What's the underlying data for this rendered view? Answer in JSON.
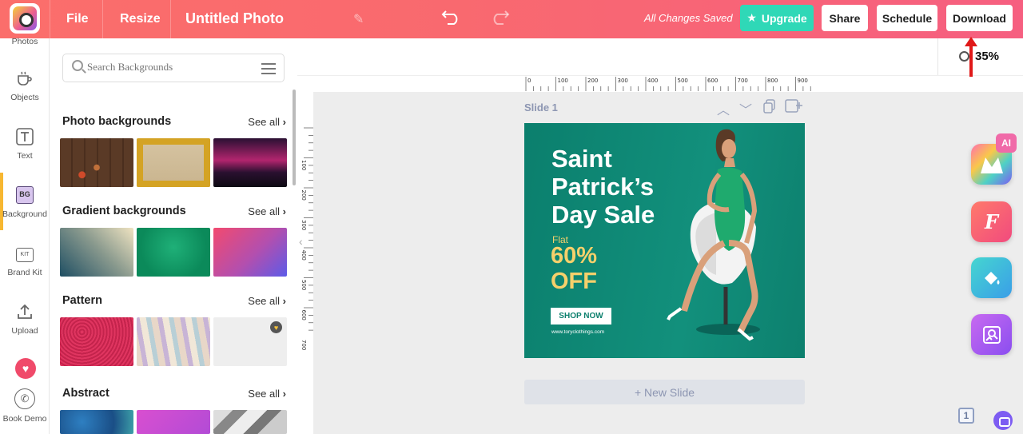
{
  "topbar": {
    "file": "File",
    "resize": "Resize",
    "title": "Untitled Photo",
    "saved": "All Changes Saved",
    "upgrade": "Upgrade",
    "share": "Share",
    "schedule": "Schedule",
    "download": "Download"
  },
  "sidebar": {
    "items": [
      {
        "label": "Photos",
        "icon": "photos-icon"
      },
      {
        "label": "Objects",
        "icon": "cup-icon"
      },
      {
        "label": "Text",
        "icon": "text-icon"
      },
      {
        "label": "Background",
        "icon": "bg-icon",
        "badge": "BG"
      },
      {
        "label": "Brand Kit",
        "icon": "kit-icon",
        "badge": "KIT"
      },
      {
        "label": "Upload",
        "icon": "upload-icon"
      },
      {
        "label": "Book Demo",
        "icon": "phone-icon"
      }
    ]
  },
  "panel": {
    "search_placeholder": "Search Backgrounds",
    "sections": [
      {
        "title": "Photo backgrounds",
        "see_all": "See all"
      },
      {
        "title": "Gradient backgrounds",
        "see_all": "See all"
      },
      {
        "title": "Pattern",
        "see_all": "See all"
      },
      {
        "title": "Abstract",
        "see_all": "See all"
      }
    ]
  },
  "canvas": {
    "zoom": "35%",
    "slide_label": "Slide 1",
    "new_slide": "+ New Slide",
    "ruler_h": [
      "0",
      "100",
      "200",
      "300",
      "400",
      "500",
      "600",
      "700",
      "800",
      "900"
    ],
    "ruler_v": [
      "100",
      "200",
      "300",
      "400",
      "500",
      "600",
      "700"
    ]
  },
  "design": {
    "headline_1": "Saint",
    "headline_2": "Patrick’s",
    "headline_3": "Day Sale",
    "flat": "Flat",
    "pct_1": "60%",
    "pct_2": "OFF",
    "cta": "SHOP NOW",
    "url": "www.toryclothings.com"
  },
  "right_tools": {
    "ai_badge": "AI",
    "font_letter": "F",
    "pages": "1"
  },
  "colors": {
    "topbar": "#fb6e6b",
    "upgrade": "#2fd8b7",
    "slide_bg": "#0f8776",
    "accent_yellow": "#f5d06b",
    "active_sidebar": "#f7b731"
  }
}
